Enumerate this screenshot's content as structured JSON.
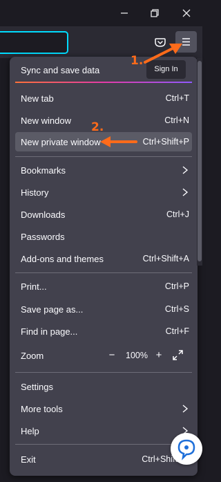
{
  "titlebar": {
    "minimize": "minimize-icon",
    "restore": "restore-icon",
    "close": "close-icon"
  },
  "toolbar": {
    "pocket_icon": "pocket-icon",
    "menu_icon": "hamburger-menu-icon"
  },
  "menu": {
    "sync_label": "Sync and save data",
    "signin_label": "Sign In",
    "items": [
      {
        "label": "New tab",
        "shortcut": "Ctrl+T"
      },
      {
        "label": "New window",
        "shortcut": "Ctrl+N"
      },
      {
        "label": "New private window",
        "shortcut": "Ctrl+Shift+P"
      },
      {
        "label": "Bookmarks"
      },
      {
        "label": "History"
      },
      {
        "label": "Downloads",
        "shortcut": "Ctrl+J"
      },
      {
        "label": "Passwords"
      },
      {
        "label": "Add-ons and themes",
        "shortcut": "Ctrl+Shift+A"
      },
      {
        "label": "Print...",
        "shortcut": "Ctrl+P"
      },
      {
        "label": "Save page as...",
        "shortcut": "Ctrl+S"
      },
      {
        "label": "Find in page...",
        "shortcut": "Ctrl+F"
      },
      {
        "label": "Zoom",
        "minus": "−",
        "value": "100%",
        "plus": "+"
      },
      {
        "label": "Settings"
      },
      {
        "label": "More tools"
      },
      {
        "label": "Help"
      },
      {
        "label": "Exit",
        "shortcut": "Ctrl+Shift+Q"
      }
    ]
  },
  "annotations": {
    "step1": "1.",
    "step2": "2.",
    "color": "#ff6b1a"
  }
}
